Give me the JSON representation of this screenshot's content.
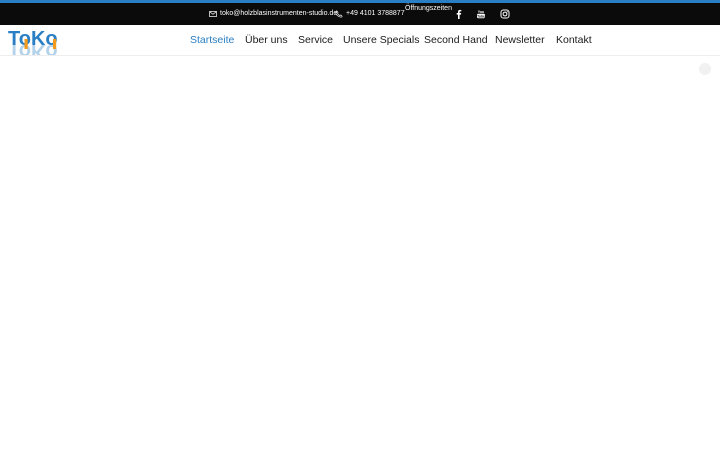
{
  "topbar": {
    "email": "toko@holzblasinstrumenten-studio.de",
    "phone": "+49 4101 3788877",
    "hours_label": "Öffnungszeiten",
    "social": [
      {
        "icon": "facebook-icon"
      },
      {
        "icon": "youtube-icon"
      },
      {
        "icon": "instagram-icon"
      }
    ]
  },
  "header": {
    "logo_text": "ToKo",
    "nav": [
      {
        "label": "Startseite",
        "active": true
      },
      {
        "label": "Über uns",
        "active": false
      },
      {
        "label": "Service",
        "active": false
      },
      {
        "label": "Unsere Specials",
        "active": false
      },
      {
        "label": "Second Hand",
        "active": false
      },
      {
        "label": "Newsletter",
        "active": false
      },
      {
        "label": "Kontakt",
        "active": false
      }
    ]
  },
  "colors": {
    "accent": "#2a7fc4",
    "topbar_bg": "#0b0b0b",
    "logo_orange": "#f29a1d"
  }
}
